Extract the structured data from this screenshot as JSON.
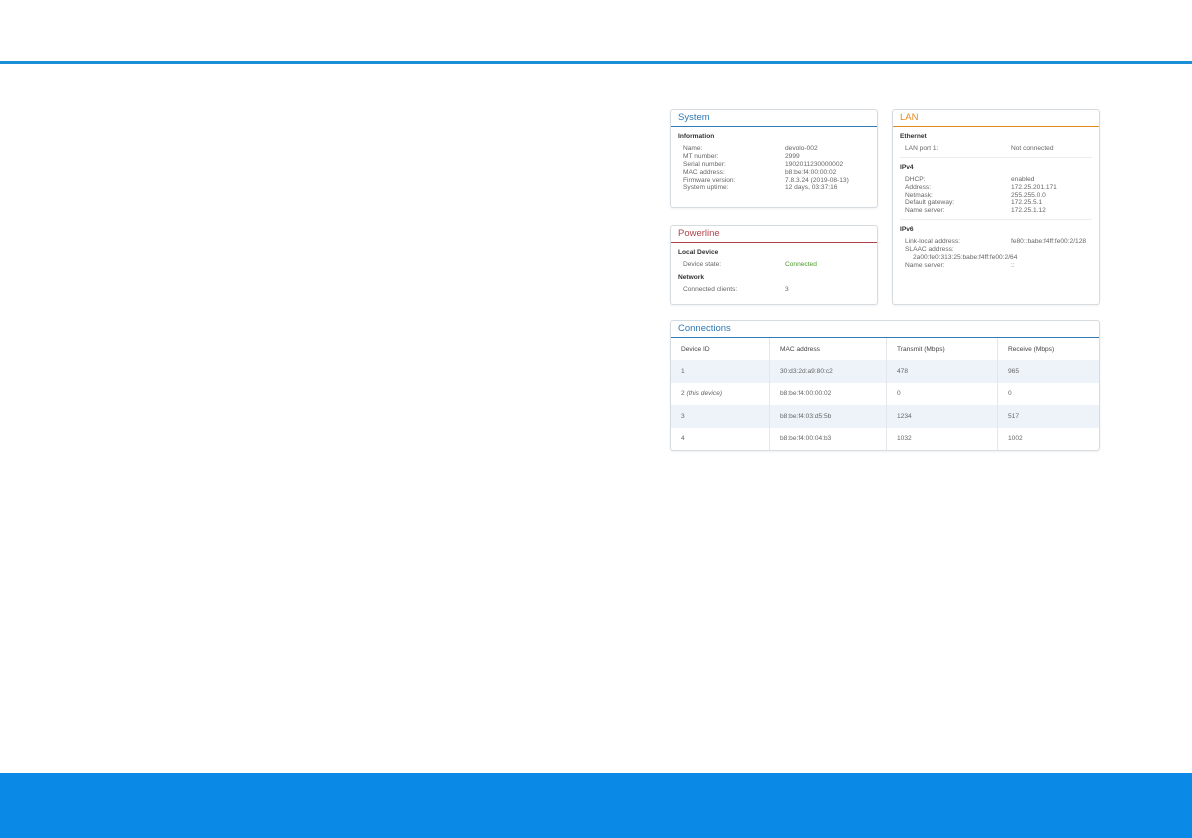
{
  "colors": {
    "accent": "#1a8fd8",
    "footer": "#0a8ae6",
    "connected": "#4a9a2a"
  },
  "system": {
    "title": "System",
    "section": "Information",
    "rows": [
      {
        "k": "Name:",
        "v": "devolo-002"
      },
      {
        "k": "MT number:",
        "v": "2999"
      },
      {
        "k": "Serial number:",
        "v": "1902011230000002"
      },
      {
        "k": "MAC address:",
        "v": "b8:be:f4:00:00:02"
      },
      {
        "k": "Firmware version:",
        "v": "7.8.3.24 (2019-08-13)"
      },
      {
        "k": "System uptime:",
        "v": "12 days, 03:37:16"
      }
    ]
  },
  "powerline": {
    "title": "Powerline",
    "local_section": "Local Device",
    "device_state_label": "Device state:",
    "device_state_value": "Connected",
    "network_section": "Network",
    "clients_label": "Connected clients:",
    "clients_value": "3"
  },
  "lan": {
    "title": "LAN",
    "ethernet_section": "Ethernet",
    "port_label": "LAN port 1:",
    "port_value": "Not connected",
    "ipv4_section": "IPv4",
    "ipv4_rows": [
      {
        "k": "DHCP:",
        "v": "enabled"
      },
      {
        "k": "Address:",
        "v": "172.25.201.171"
      },
      {
        "k": "Netmask:",
        "v": "255.255.0.0"
      },
      {
        "k": "Default gateway:",
        "v": "172.25.5.1"
      },
      {
        "k": "Name server:",
        "v": "172.25.1.12"
      }
    ],
    "ipv6_section": "IPv6",
    "link_local_label": "Link-local address:",
    "link_local_value": "fe80::babe:f4ff:fe00:2/128",
    "slaac_label": "SLAAC address:",
    "slaac_value": "2a00:fe0:313:25:babe:f4ff:fe00:2/64",
    "ns6_label": "Name server:",
    "ns6_value": "::"
  },
  "connections": {
    "title": "Connections",
    "headers": [
      "Device ID",
      "MAC address",
      "Transmit (Mbps)",
      "Receive (Mbps)"
    ],
    "rows": [
      {
        "id": "1",
        "note": "",
        "mac": "30:d3:2d:a9:80:c2",
        "tx": "478",
        "rx": "965"
      },
      {
        "id": "2",
        "note": "(this device)",
        "mac": "b8:be:f4:00:00:02",
        "tx": "0",
        "rx": "0"
      },
      {
        "id": "3",
        "note": "",
        "mac": "b8:be:f4:03:d5:5b",
        "tx": "1234",
        "rx": "517"
      },
      {
        "id": "4",
        "note": "",
        "mac": "b8:be:f4:00:04:b3",
        "tx": "1032",
        "rx": "1002"
      }
    ]
  }
}
